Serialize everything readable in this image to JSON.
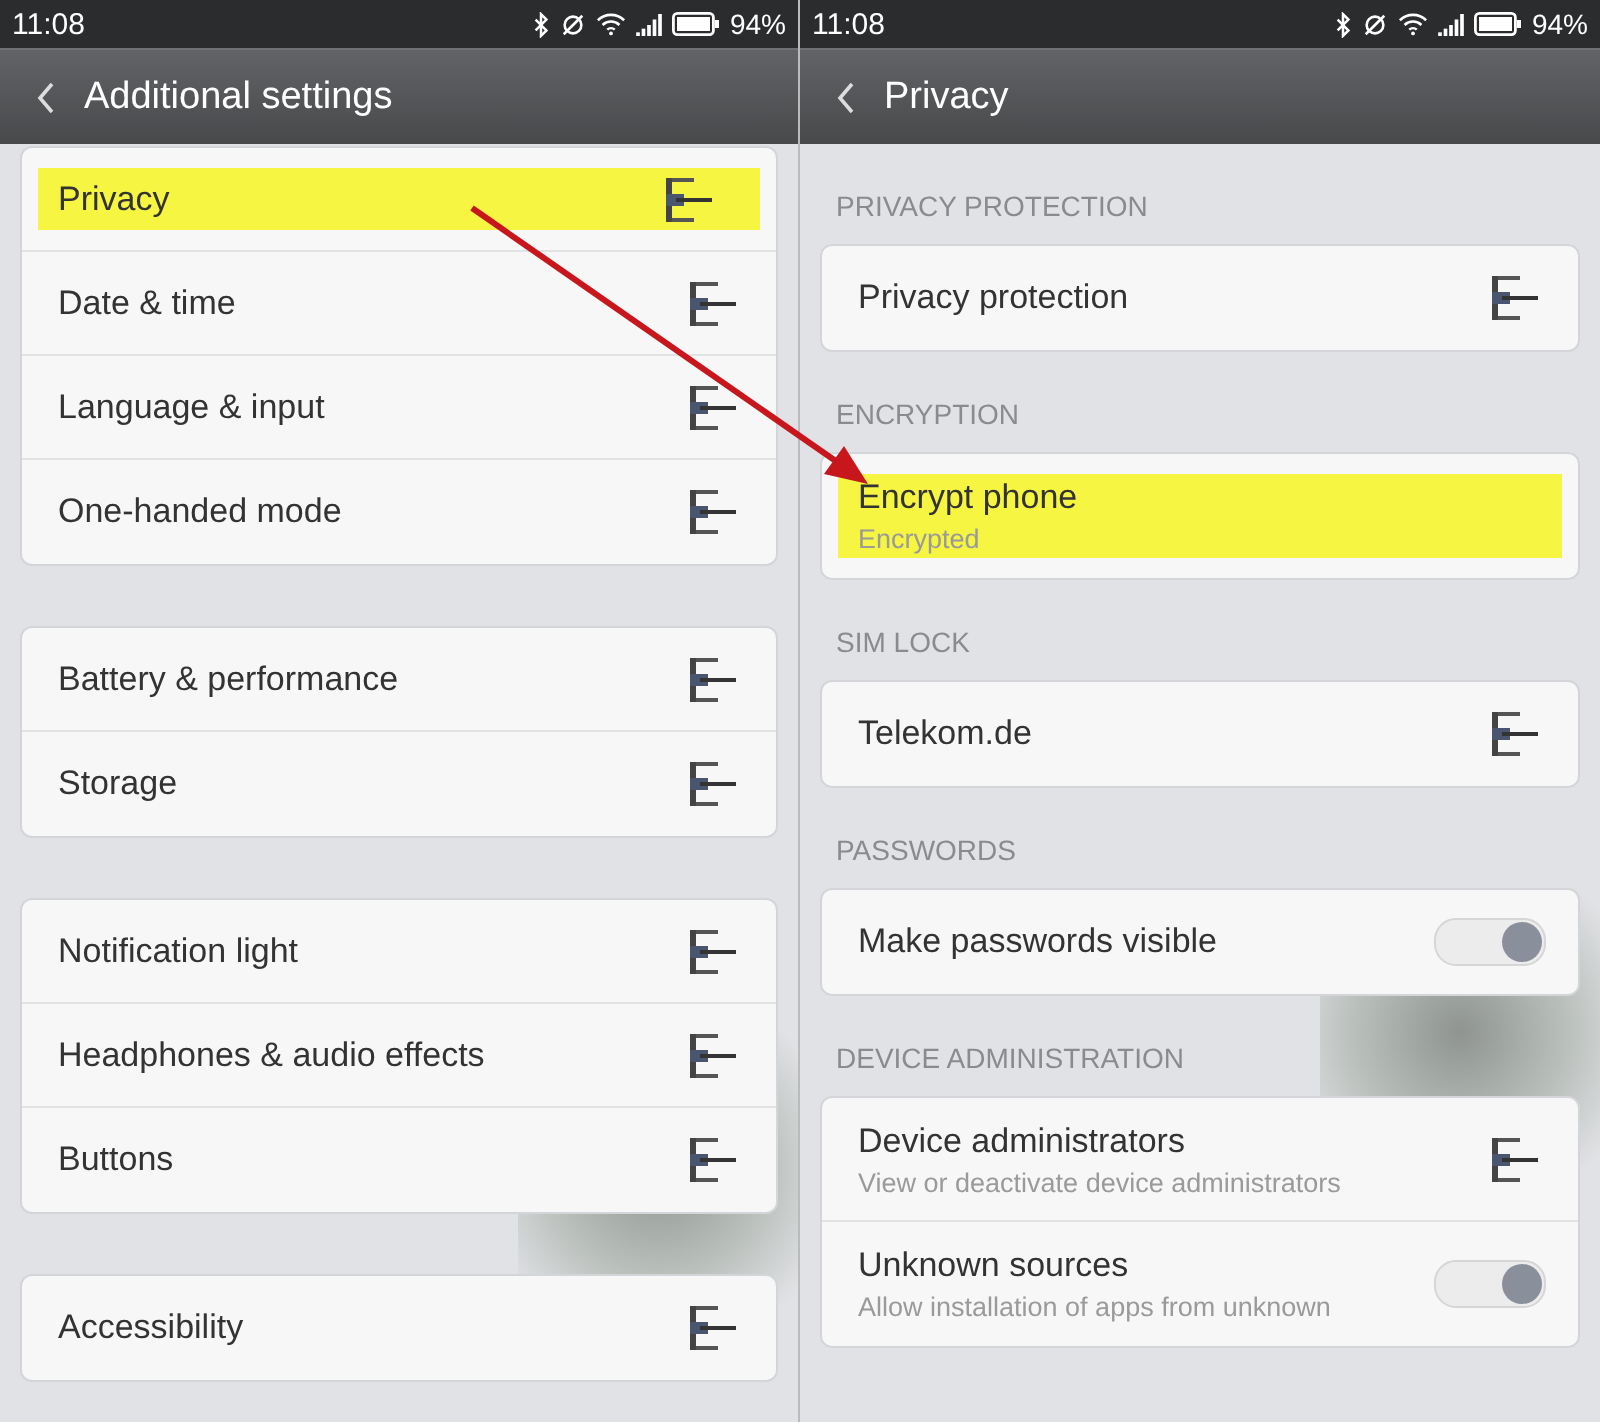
{
  "panels": [
    {
      "status_bar": {
        "time": "11:08",
        "battery": "94%"
      },
      "title": "Additional settings",
      "groups": [
        {
          "items": [
            {
              "title": "Privacy",
              "kind": "link",
              "highlighted": true
            },
            {
              "title": "Date & time",
              "kind": "link",
              "highlighted": false
            },
            {
              "title": "Language & input",
              "kind": "link",
              "highlighted": false
            },
            {
              "title": "One-handed mode",
              "kind": "link",
              "highlighted": false
            }
          ]
        },
        {
          "items": [
            {
              "title": "Battery & performance",
              "kind": "link",
              "highlighted": false
            },
            {
              "title": "Storage",
              "kind": "link",
              "highlighted": false
            }
          ]
        },
        {
          "items": [
            {
              "title": "Notification light",
              "kind": "link",
              "highlighted": false
            },
            {
              "title": "Headphones & audio effects",
              "kind": "link",
              "highlighted": false
            },
            {
              "title": "Buttons",
              "kind": "link",
              "highlighted": false
            }
          ]
        },
        {
          "items": [
            {
              "title": "Accessibility",
              "kind": "link",
              "highlighted": false
            }
          ]
        }
      ]
    },
    {
      "status_bar": {
        "time": "11:08",
        "battery": "94%"
      },
      "title": "Privacy",
      "groups": [
        {
          "header": "PRIVACY PROTECTION",
          "items": [
            {
              "title": "Privacy protection",
              "kind": "link",
              "highlighted": false
            }
          ]
        },
        {
          "header": "ENCRYPTION",
          "items": [
            {
              "title": "Encrypt phone",
              "subtitle": "Encrypted",
              "kind": "info",
              "highlighted": true
            }
          ]
        },
        {
          "header": "SIM LOCK",
          "items": [
            {
              "title": "Telekom.de",
              "kind": "link",
              "highlighted": false
            }
          ]
        },
        {
          "header": "PASSWORDS",
          "items": [
            {
              "title": "Make passwords visible",
              "kind": "toggle",
              "on": true,
              "highlighted": false
            }
          ]
        },
        {
          "header": "DEVICE ADMINISTRATION",
          "items": [
            {
              "title": "Device administrators",
              "subtitle": "View or deactivate device administrators",
              "kind": "link",
              "highlighted": false
            },
            {
              "title": "Unknown sources",
              "subtitle": "Allow installation of apps from unknown",
              "kind": "toggle",
              "on": true,
              "highlighted": false
            }
          ]
        }
      ]
    }
  ]
}
